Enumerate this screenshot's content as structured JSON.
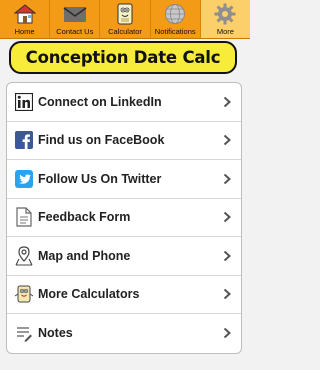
{
  "tabs": [
    {
      "label": "Home",
      "icon": "home-icon",
      "active": false
    },
    {
      "label": "Contact Us",
      "icon": "envelope-icon",
      "active": false
    },
    {
      "label": "Calculator",
      "icon": "calculator-mascot-icon",
      "active": false
    },
    {
      "label": "Notifications",
      "icon": "globe-icon",
      "active": false
    },
    {
      "label": "More",
      "icon": "gear-icon",
      "active": true
    }
  ],
  "banner": {
    "title": "Conception Date Calc"
  },
  "menu": [
    {
      "label": "Connect on LinkedIn",
      "icon": "linkedin-icon"
    },
    {
      "label": "Find us on FaceBook",
      "icon": "facebook-icon"
    },
    {
      "label": "Follow Us On Twitter",
      "icon": "twitter-icon"
    },
    {
      "label": "Feedback Form",
      "icon": "document-icon"
    },
    {
      "label": "Map and Phone",
      "icon": "map-pin-icon"
    },
    {
      "label": "More Calculators",
      "icon": "calculator-mascot-icon"
    },
    {
      "label": "Notes",
      "icon": "notes-icon"
    }
  ],
  "colors": {
    "tabbar": "#f39a16",
    "active_tab": "#fbd06a",
    "banner": "#f7ec3a"
  }
}
